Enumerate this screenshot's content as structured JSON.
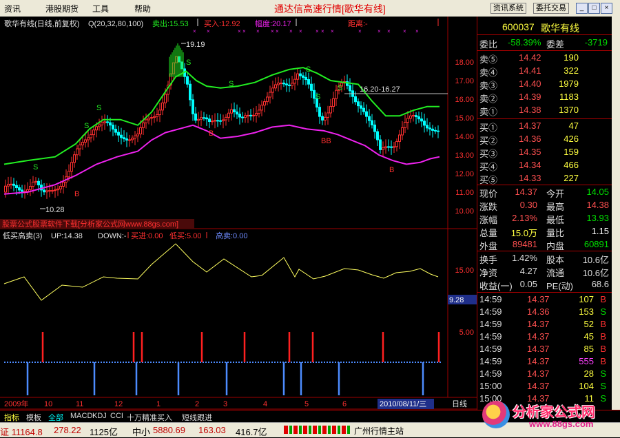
{
  "menu": {
    "items": [
      "资讯",
      "港股期货",
      "工具",
      "帮助"
    ],
    "title": "通达信高速行情",
    "title_sub": "[歌华有线]",
    "btn_info": "资讯系统",
    "btn_trade": "委托交易"
  },
  "main_chart": {
    "header": {
      "name": "歌华有线(日线,前复权)",
      "params": "Q(20,32,80,100)",
      "sell_label": "卖出:15.53",
      "buy_label": "买入:12.92",
      "range_label": "幅度:20.17",
      "dist_label": "距离:-"
    },
    "price_axis": [
      "18.00",
      "17.00",
      "16.00",
      "15.00",
      "14.00",
      "13.00",
      "12.00",
      "11.00",
      "10.00"
    ],
    "annotations": {
      "high": "19.19",
      "low": "10.28",
      "range_line": "16.20-16.27"
    },
    "markers": {
      "s": "S",
      "b": "B",
      "bb": "BB"
    },
    "watermark": "股票公式股票软件下载[分析家公式网www.88gs.com]"
  },
  "sub_chart": {
    "header": {
      "name": "低买高卖(3)",
      "up": "UP:14.38",
      "down": "DOWN:-",
      "buy_in": "买进:0.00",
      "low_sell": "低买:5.00",
      "high_sell": "高卖:0.00"
    },
    "axis": [
      "15.00",
      "9.28",
      "5.00"
    ]
  },
  "time_axis": {
    "labels": [
      "2009年",
      "10",
      "11",
      "12",
      "1",
      "2",
      "3",
      "4",
      "5",
      "6"
    ],
    "cursor_date": "2010/08/11/三",
    "period": "日线"
  },
  "quote": {
    "code": "600037",
    "name": "歌华有线",
    "ratio_label": "委比",
    "ratio": "-58.39%",
    "diff_label": "委差",
    "diff": "-3719",
    "sells": [
      {
        "label": "卖⑤",
        "price": "14.42",
        "vol": "190"
      },
      {
        "label": "卖④",
        "price": "14.41",
        "vol": "322"
      },
      {
        "label": "卖③",
        "price": "14.40",
        "vol": "1979"
      },
      {
        "label": "卖②",
        "price": "14.39",
        "vol": "1183"
      },
      {
        "label": "卖①",
        "price": "14.38",
        "vol": "1370"
      }
    ],
    "buys": [
      {
        "label": "买①",
        "price": "14.37",
        "vol": "47"
      },
      {
        "label": "买②",
        "price": "14.36",
        "vol": "426"
      },
      {
        "label": "买③",
        "price": "14.35",
        "vol": "159"
      },
      {
        "label": "买④",
        "price": "14.34",
        "vol": "466"
      },
      {
        "label": "买⑤",
        "price": "14.33",
        "vol": "227"
      }
    ],
    "stats": [
      {
        "l1": "现价",
        "v1": "14.37",
        "c1": "#ff5050",
        "l2": "今开",
        "v2": "14.05",
        "c2": "#00e000"
      },
      {
        "l1": "涨跌",
        "v1": "0.30",
        "c1": "#ff5050",
        "l2": "最高",
        "v2": "14.38",
        "c2": "#ff5050"
      },
      {
        "l1": "涨幅",
        "v1": "2.13%",
        "c1": "#ff5050",
        "l2": "最低",
        "v2": "13.93",
        "c2": "#00e000"
      },
      {
        "l1": "总量",
        "v1": "15.0万",
        "c1": "#ffff40",
        "l2": "量比",
        "v2": "1.15",
        "c2": "#ffffff"
      },
      {
        "l1": "外盘",
        "v1": "89481",
        "c1": "#ff5050",
        "l2": "内盘",
        "v2": "60891",
        "c2": "#00e000"
      }
    ],
    "stats2": [
      {
        "l1": "换手",
        "v1": "1.42%",
        "l2": "股本",
        "v2": "10.6亿"
      },
      {
        "l1": "净资",
        "v1": "4.27",
        "l2": "流通",
        "v2": "10.6亿"
      },
      {
        "l1": "收益(一)",
        "v1": "0.05",
        "l2": "PE(动)",
        "v2": "68.6"
      }
    ],
    "ticks": [
      {
        "time": "14:59",
        "price": "14.37",
        "vol": "107",
        "side": "B"
      },
      {
        "time": "14:59",
        "price": "14.36",
        "vol": "153",
        "side": "S"
      },
      {
        "time": "14:59",
        "price": "14.37",
        "vol": "52",
        "side": "B"
      },
      {
        "time": "14:59",
        "price": "14.37",
        "vol": "45",
        "side": "B"
      },
      {
        "time": "14:59",
        "price": "14.37",
        "vol": "85",
        "side": "B"
      },
      {
        "time": "14:59",
        "price": "14.37",
        "vol": "555",
        "side": "B"
      },
      {
        "time": "14:59",
        "price": "14.37",
        "vol": "28",
        "side": "S"
      },
      {
        "time": "15:00",
        "price": "14.37",
        "vol": "104",
        "side": "S"
      },
      {
        "time": "15:00",
        "price": "14.37",
        "vol": "11",
        "side": "S"
      }
    ]
  },
  "tabs": [
    "指标",
    "模板",
    "全部",
    "MACD",
    "KDJ",
    "CCI",
    "十万精准买入",
    "短线跟进"
  ],
  "status": {
    "index_sh": "证 11164.8",
    "change": "278.22",
    "amount": "1125亿",
    "sme_label": "中小",
    "sme_value": "5880.69",
    "sme_change": "163.03",
    "sme_amount": "416.7亿",
    "station": "广州行情主站"
  },
  "logo": {
    "name": "分析家公式网",
    "url": "www.88gs.com"
  },
  "colors": {
    "up": "#ff3030",
    "down": "#00ffff",
    "ma_green": "#22ee22",
    "ma_magenta": "#ee22ee",
    "yellow": "#ffff40",
    "blue_bars": "#4d8cff",
    "grid_red": "#a00000"
  }
}
